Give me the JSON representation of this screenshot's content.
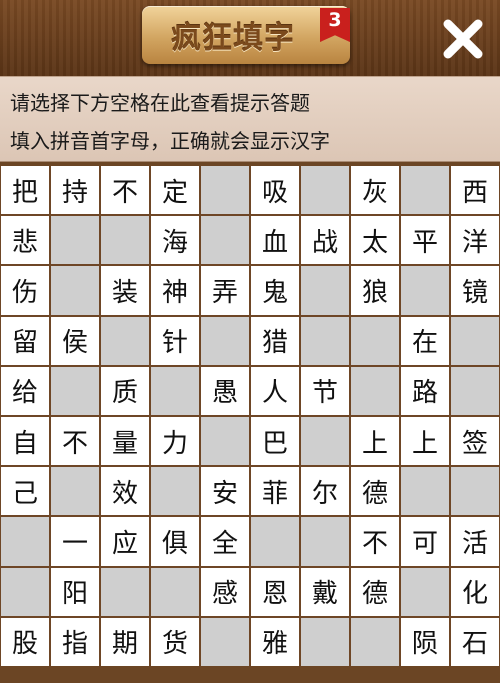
{
  "header": {
    "title": "疯狂填字",
    "level_badge": "3",
    "close_icon": "close-icon"
  },
  "hints": {
    "line1": "请选择下方空格在此查看提示答题",
    "line2": "填入拼音首字母，正确就会显示汉字"
  },
  "colors": {
    "wood": "#6b4524",
    "hint_bg": "#e3cfc0",
    "cell": "#ffffff",
    "blocked_cell": "#cfcfcf",
    "badge_red": "#c9201d"
  },
  "grid": {
    "rows": [
      [
        "把",
        "持",
        "不",
        "定",
        "#",
        "吸",
        "#",
        "灰",
        "#",
        "西"
      ],
      [
        "悲",
        "#",
        "#",
        "海",
        "#",
        "血",
        "战",
        "太",
        "平",
        "洋"
      ],
      [
        "伤",
        "#",
        "装",
        "神",
        "弄",
        "鬼",
        "#",
        "狼",
        "#",
        "镜"
      ],
      [
        "留",
        "侯",
        "#",
        "针",
        "#",
        "猎",
        "#",
        "#",
        "在",
        "#"
      ],
      [
        "给",
        "#",
        "质",
        "#",
        "愚",
        "人",
        "节",
        "#",
        "路",
        "#"
      ],
      [
        "自",
        "不",
        "量",
        "力",
        "#",
        "巴",
        "#",
        "上",
        "上",
        "签"
      ],
      [
        "己",
        "#",
        "效",
        "#",
        "安",
        "菲",
        "尔",
        "德",
        "#",
        "#"
      ],
      [
        "#",
        "一",
        "应",
        "俱",
        "全",
        "#",
        "#",
        "不",
        "可",
        "活"
      ],
      [
        "#",
        "阳",
        "#",
        "#",
        "感",
        "恩",
        "戴",
        "德",
        "#",
        "化"
      ],
      [
        "股",
        "指",
        "期",
        "货",
        "#",
        "雅",
        "#",
        "#",
        "陨",
        "石"
      ]
    ]
  }
}
